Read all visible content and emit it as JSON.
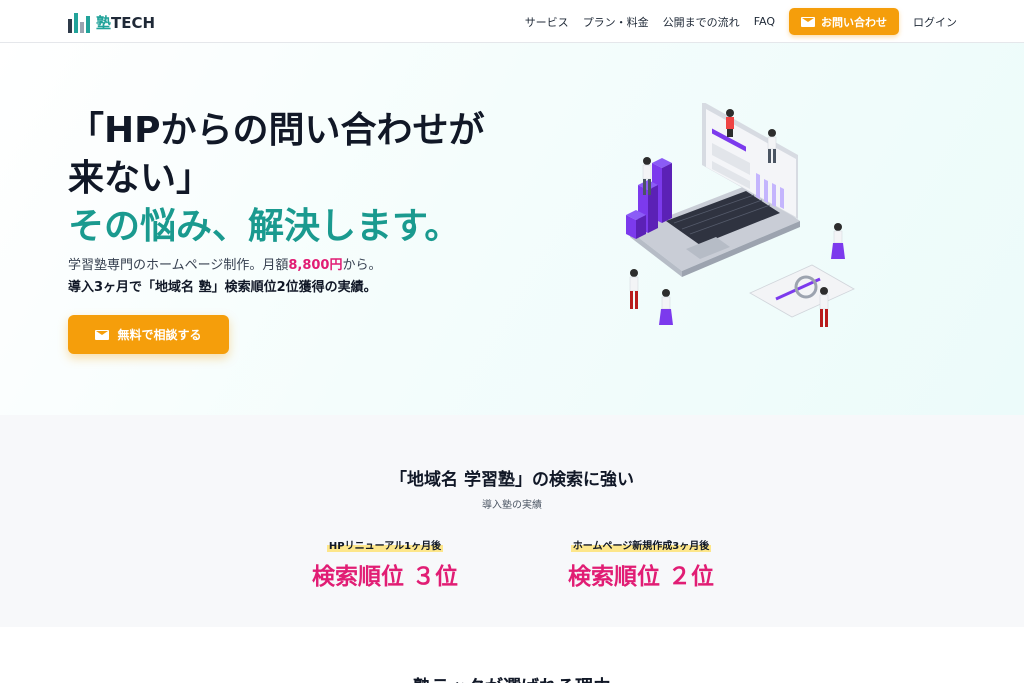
{
  "header": {
    "brand_kanji": "塾",
    "brand_text": "TECH",
    "nav": [
      "サービス",
      "プラン・料金",
      "公開までの流れ",
      "FAQ"
    ],
    "contact_button": "お問い合わせ",
    "login": "ログイン"
  },
  "hero": {
    "title_line1": "「HPからの問い合わせが",
    "title_line2": "来ない」",
    "title_accent": "その悩み、解決します。",
    "sub1_prefix": "学習塾専門のホームページ制作。月額",
    "sub1_price": "8,800円",
    "sub1_suffix": "から。",
    "sub2": "導入3ヶ月で「地域名 塾」検索順位2位獲得の実績。",
    "cta": "無料で相談する"
  },
  "results": {
    "title": "「地域名 学習塾」の検索に強い",
    "subtitle": "導入塾の実績",
    "stats": [
      {
        "label": "HPリニューアル1ヶ月後",
        "value": "検索順位 ３位"
      },
      {
        "label": "ホームページ新規作成3ヶ月後",
        "value": "検索順位 ２位"
      }
    ]
  },
  "next_section": {
    "title": "塾テックが選ばれる理由"
  },
  "colors": {
    "accent_teal": "#1a9a8f",
    "cta_orange": "#f59e0b",
    "highlight_pink": "#e11d74",
    "illustration_purple": "#7c3aed"
  }
}
